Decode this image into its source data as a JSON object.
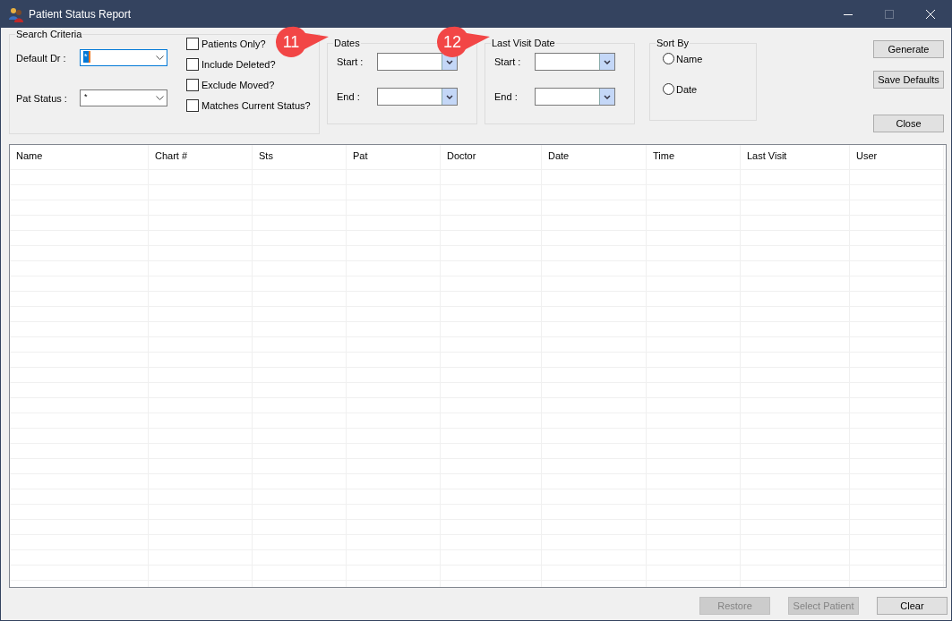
{
  "window": {
    "title": "Patient Status Report"
  },
  "search_criteria": {
    "legend": "Search Criteria",
    "fields": [
      {
        "label": "Default Dr :",
        "value": "*",
        "focused": true
      },
      {
        "label": "Pat Status :",
        "value": "*",
        "focused": false
      }
    ],
    "checkboxes": [
      {
        "label": "Patients Only?",
        "checked": false
      },
      {
        "label": "Include Deleted?",
        "checked": false
      },
      {
        "label": "Exclude Moved?",
        "checked": false
      },
      {
        "label": "Matches Current Status?",
        "checked": false
      }
    ]
  },
  "date_groups": [
    {
      "legend": "Dates",
      "callout": "11",
      "fields": [
        {
          "label": "Start :"
        },
        {
          "label": "End :"
        }
      ]
    },
    {
      "legend": "Last Visit Date",
      "callout": "12",
      "fields": [
        {
          "label": "Start :"
        },
        {
          "label": "End :"
        }
      ]
    }
  ],
  "sort_by": {
    "legend": "Sort By",
    "options": [
      {
        "label": "Name",
        "selected": false
      },
      {
        "label": "Date",
        "selected": false
      }
    ]
  },
  "side_buttons": [
    {
      "label": "Generate"
    },
    {
      "label": "Save Defaults"
    },
    {
      "label": "Close"
    }
  ],
  "table": {
    "columns": [
      "Name",
      "Chart #",
      "Sts",
      "Pat",
      "Doctor",
      "Date",
      "Time",
      "Last Visit",
      "User"
    ]
  },
  "bottom_buttons": [
    {
      "label": "Restore",
      "disabled": true
    },
    {
      "label": "Select Patient",
      "disabled": true
    },
    {
      "label": "Clear",
      "disabled": false
    }
  ]
}
